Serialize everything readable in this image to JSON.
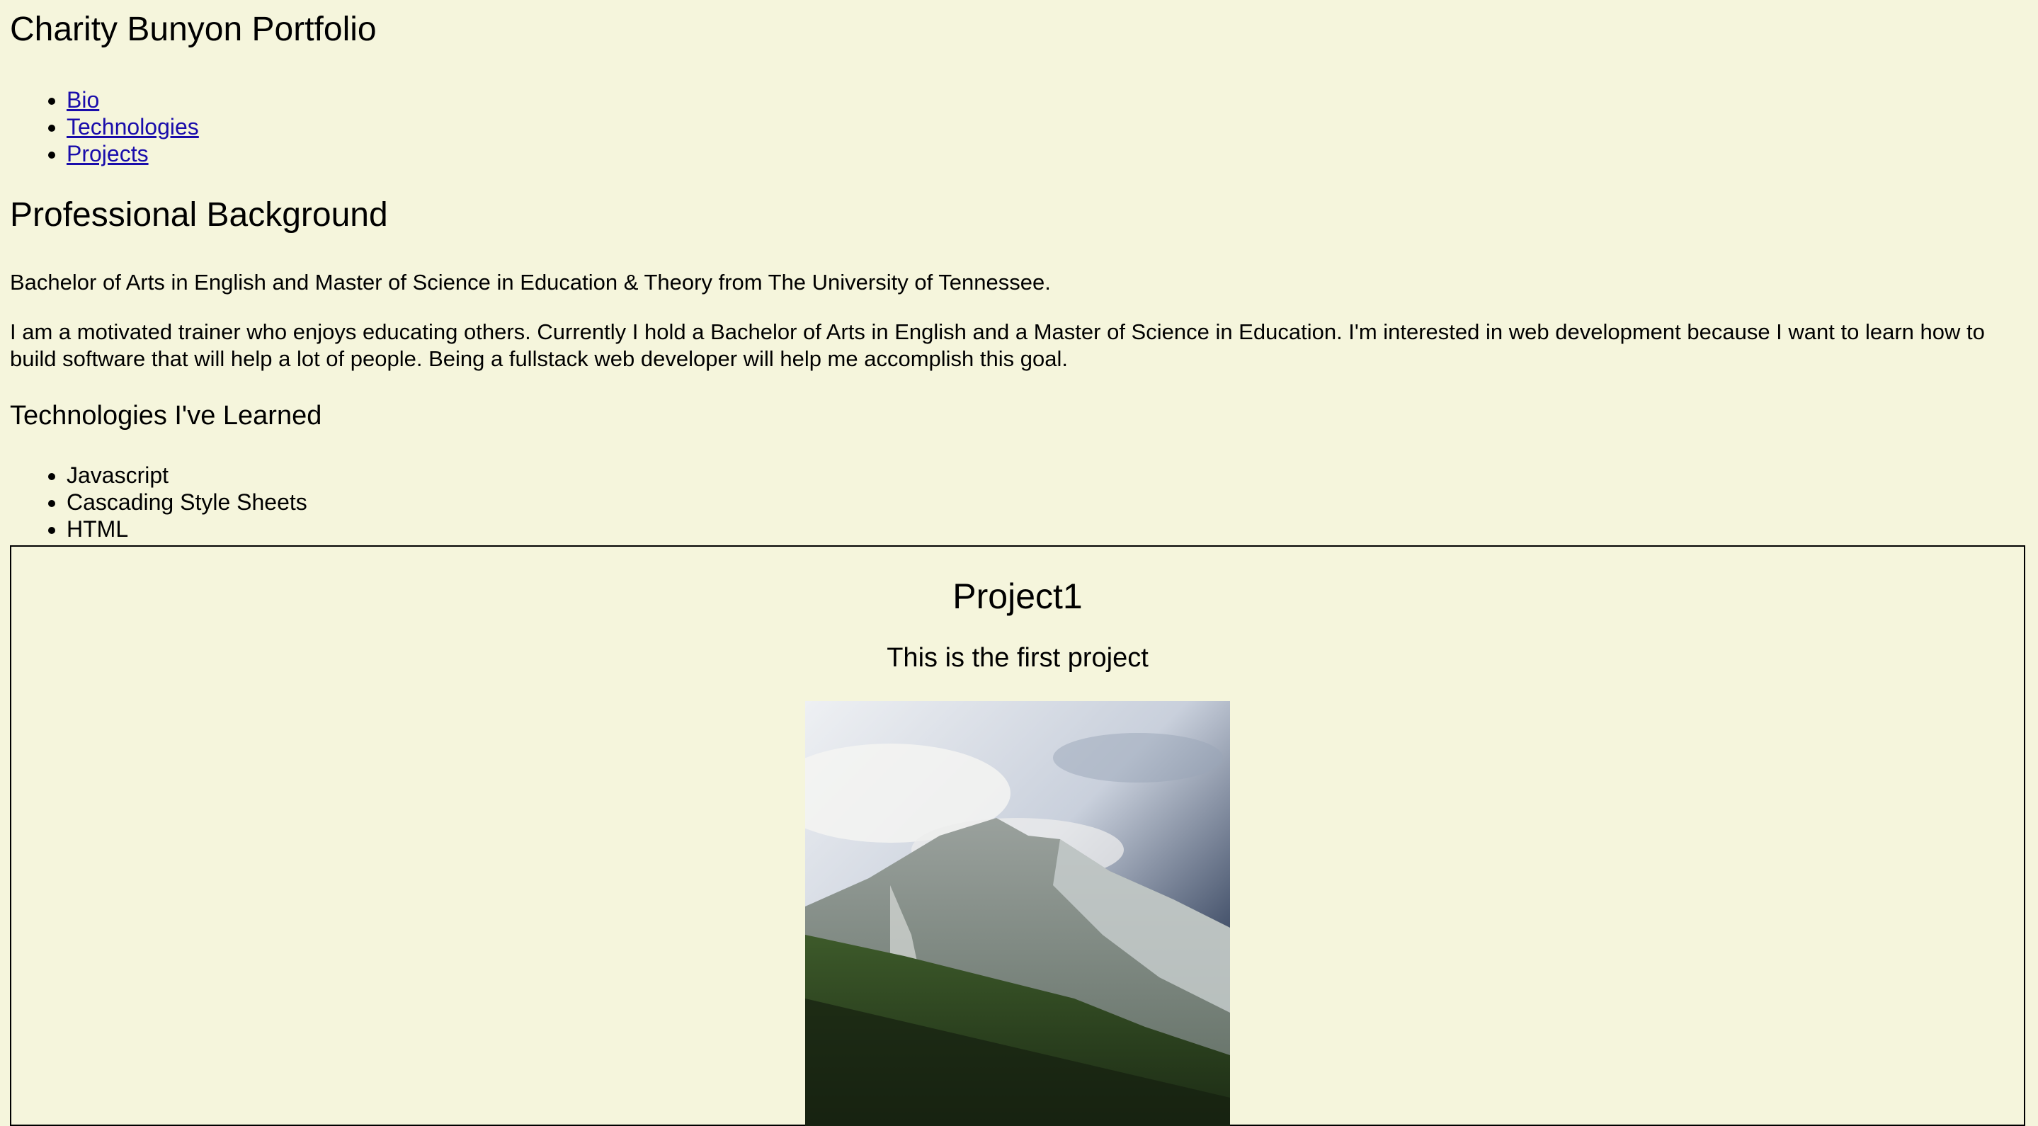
{
  "header": {
    "title": "Charity Bunyon Portfolio"
  },
  "nav": {
    "items": [
      {
        "label": "Bio"
      },
      {
        "label": "Technologies"
      },
      {
        "label": "Projects"
      }
    ]
  },
  "bio": {
    "heading": "Professional Background",
    "degrees": "Bachelor of Arts in English and Master of Science in Education & Theory from The University of Tennessee.",
    "about": "I am a motivated trainer who enjoys educating others. Currently I hold a Bachelor of Arts in English and a Master of Science in Education. I'm interested in web development because I want to learn how to build software that will help a lot of people. Being a fullstack web developer will help me accomplish this goal."
  },
  "technologies": {
    "heading": "Technologies I've Learned",
    "items": [
      {
        "label": "Javascript"
      },
      {
        "label": "Cascading Style Sheets"
      },
      {
        "label": "HTML"
      }
    ]
  },
  "projects": [
    {
      "title": "Project1",
      "description": "This is the first project",
      "image_icon": "mountain-photo"
    }
  ],
  "colors": {
    "background": "#f5f5dc",
    "link": "#1a0dab",
    "text": "#000000"
  }
}
